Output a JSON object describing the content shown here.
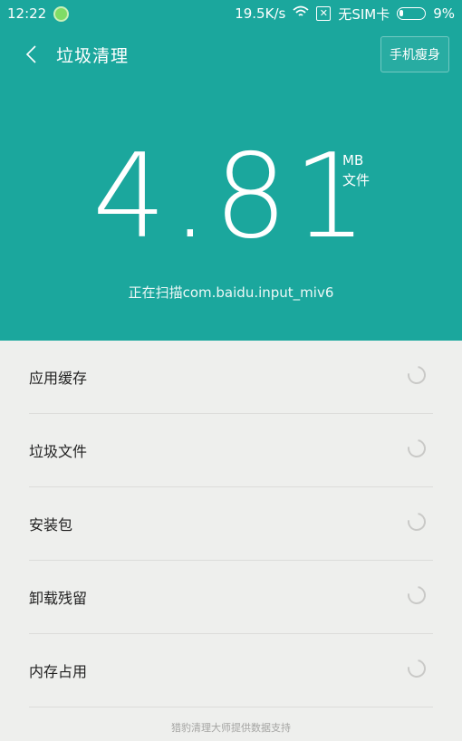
{
  "status_bar": {
    "time": "12:22",
    "net_speed": "19.5K/s",
    "sim": "无SIM卡",
    "battery": "9%"
  },
  "header": {
    "title": "垃圾清理",
    "slim_button": "手机瘦身"
  },
  "scan": {
    "size_value": "4.81",
    "unit_mb": "MB",
    "unit_file": "文件",
    "status": "正在扫描com.baidu.input_miv6"
  },
  "categories": [
    {
      "label": "应用缓存"
    },
    {
      "label": "垃圾文件"
    },
    {
      "label": "安装包"
    },
    {
      "label": "卸载残留"
    },
    {
      "label": "内存占用"
    }
  ],
  "footer": "猎豹清理大师提供数据支持",
  "colors": {
    "accent": "#1ba79d",
    "background": "#eeefed"
  }
}
